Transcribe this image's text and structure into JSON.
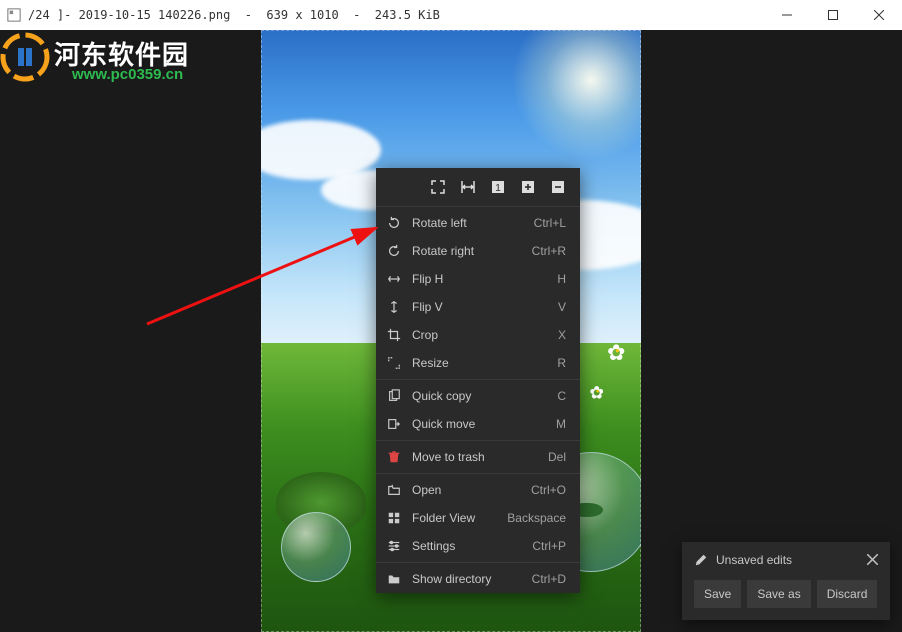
{
  "titlebar": {
    "filename": "/24 ]- 2019-10-15 140226.png",
    "dimensions": "639 x 1010",
    "filesize": "243.5 KiB"
  },
  "watermark": {
    "text_cn": "河东软件园",
    "url": "www.pc0359.cn"
  },
  "toolbar": {
    "fullscreen": "fullscreen",
    "fit": "fit-width",
    "actual": "1",
    "zoom_in": "+",
    "zoom_out": "−"
  },
  "menu": {
    "rotate_left": {
      "label": "Rotate left",
      "shortcut": "Ctrl+L"
    },
    "rotate_right": {
      "label": "Rotate right",
      "shortcut": "Ctrl+R"
    },
    "flip_h": {
      "label": "Flip H",
      "shortcut": "H"
    },
    "flip_v": {
      "label": "Flip V",
      "shortcut": "V"
    },
    "crop": {
      "label": "Crop",
      "shortcut": "X"
    },
    "resize": {
      "label": "Resize",
      "shortcut": "R"
    },
    "quick_copy": {
      "label": "Quick copy",
      "shortcut": "C"
    },
    "quick_move": {
      "label": "Quick move",
      "shortcut": "M"
    },
    "trash": {
      "label": "Move to trash",
      "shortcut": "Del"
    },
    "open": {
      "label": "Open",
      "shortcut": "Ctrl+O"
    },
    "folder_view": {
      "label": "Folder View",
      "shortcut": "Backspace"
    },
    "settings": {
      "label": "Settings",
      "shortcut": "Ctrl+P"
    },
    "show_dir": {
      "label": "Show directory",
      "shortcut": "Ctrl+D"
    }
  },
  "save_panel": {
    "title": "Unsaved edits",
    "save": "Save",
    "save_as": "Save as",
    "discard": "Discard"
  }
}
